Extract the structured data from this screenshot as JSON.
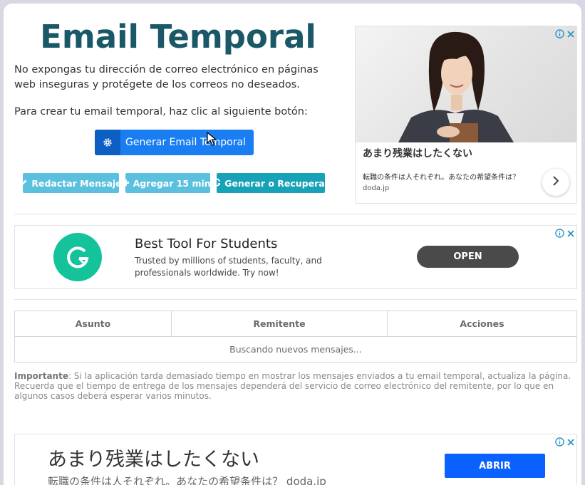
{
  "page": {
    "title": "Email Temporal",
    "intro": "No expongas tu dirección de correo electrónico en páginas web inseguras y protégete de los correos no deseados.",
    "instruction": "Para crear tu email temporal, haz clic al siguiente botón:",
    "generate_button": "Generar Email Temporal",
    "actions": {
      "compose": "Redactar Mensaje",
      "add_time": "Agregar 15 min.",
      "regenerate": "Generar o Recuperar"
    }
  },
  "inbox": {
    "columns": [
      "Asunto",
      "Remitente",
      "Acciones"
    ],
    "status": "Buscando nuevos mensajes..."
  },
  "note": {
    "label": "Importante",
    "text": ": Si la aplicación tarda demasiado tiempo en mostrar los mensajes enviados a tu email temporal, actualiza la página. Recuerda que el tiempo de entrega de los mensajes dependerá del servicio de correo electrónico del remitente, por lo que en algunos casos deberá esperar varios minutos."
  },
  "ads": {
    "side": {
      "headline": "あまり残業はしたくない",
      "sub": "転職の条件は人それぞれ。あなたの希望条件は？",
      "domain": "doda.jp"
    },
    "wide": {
      "headline": "Best Tool For Students",
      "description": "Trusted by millions of students, faculty, and professionals worldwide. Try now!",
      "cta": "OPEN"
    },
    "bottom": {
      "headline": "あまり残業はしたくない",
      "description": "転職の条件は人それぞれ。あなたの希望条件は？ doda.jp",
      "cta": "ABRIR"
    }
  },
  "icons": {
    "generate": "gear-icon",
    "compose": "pencil-icon",
    "add_time": "plus-icon",
    "regenerate": "refresh-icon",
    "ad_info": "info-icon",
    "ad_close": "close-icon",
    "ad_next": "chevron-right-icon",
    "grammarly_logo": "grammarly-logo"
  },
  "colors": {
    "title": "#1a5868",
    "primary": "#1a7ef2",
    "info": "#5bc0de",
    "teal": "#17a2b8"
  }
}
